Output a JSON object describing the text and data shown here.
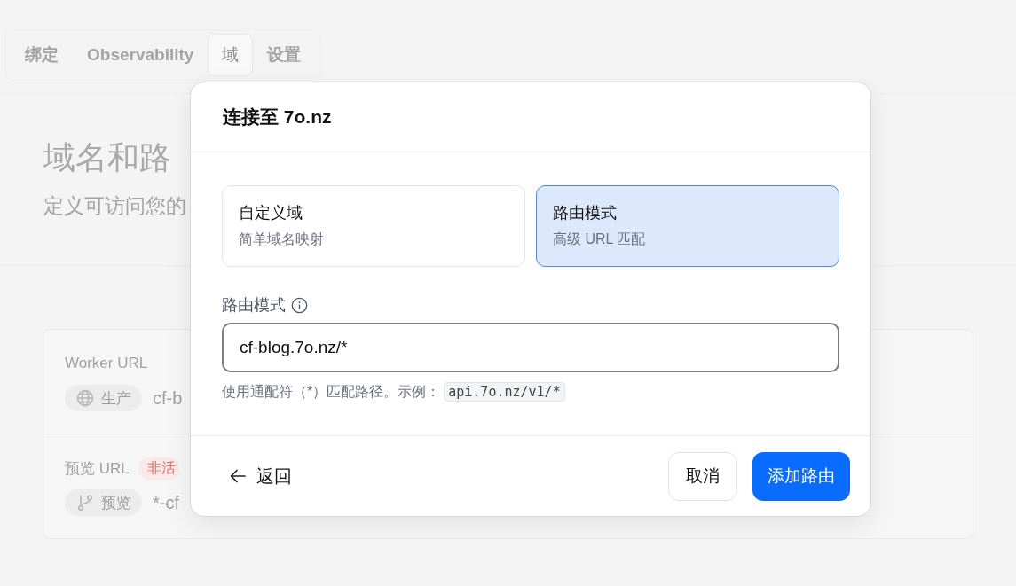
{
  "tabs": [
    {
      "label": "绑定",
      "selected": false
    },
    {
      "label": "Observability",
      "selected": false
    },
    {
      "label": "域",
      "selected": true
    },
    {
      "label": "设置",
      "selected": false
    }
  ],
  "page": {
    "title": "域名和路",
    "subtitle": "定义可访问您的"
  },
  "url_card": {
    "rows": [
      {
        "kind": "production",
        "label": "Worker URL",
        "tag": "生产",
        "value": "cf-b"
      },
      {
        "kind": "preview",
        "label": "预览 URL",
        "status": "非活",
        "tag": "预览",
        "value": "*-cf"
      }
    ]
  },
  "dialog": {
    "title": "连接至 7o.nz",
    "options": [
      {
        "title": "自定义域",
        "description": "简单域名映射",
        "selected": false
      },
      {
        "title": "路由模式",
        "description": "高级 URL 匹配",
        "selected": true
      }
    ],
    "field": {
      "label": "路由模式",
      "value": "cf-blog.7o.nz/*",
      "help": "使用通配符（*）匹配路径。示例：",
      "example": "api.7o.nz/v1/*"
    },
    "back_button": "返回",
    "cancel_button": "取消",
    "submit_button": "添加路由"
  }
}
